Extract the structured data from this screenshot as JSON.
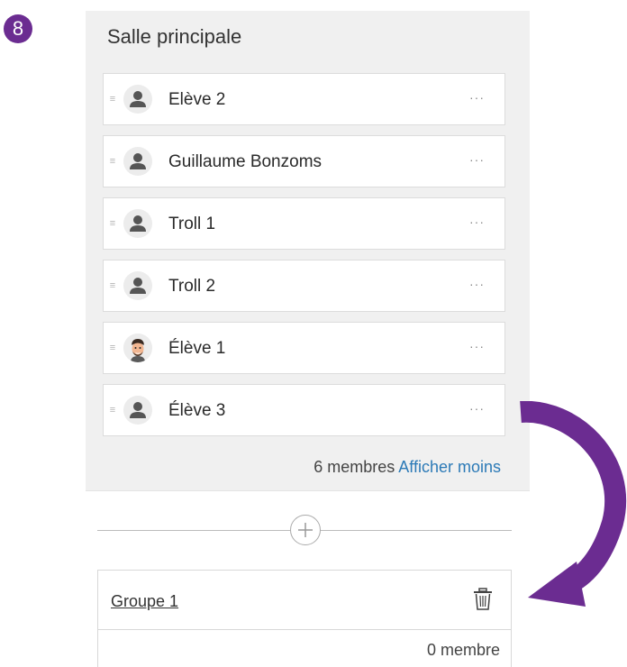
{
  "step_number": "8",
  "room": {
    "title": "Salle principale",
    "members": [
      {
        "name": "Elève 2",
        "avatar": "person-icon"
      },
      {
        "name": "Guillaume Bonzoms",
        "avatar": "person-icon"
      },
      {
        "name": "Troll 1",
        "avatar": "person-icon"
      },
      {
        "name": "Troll 2",
        "avatar": "person-icon"
      },
      {
        "name": "Élève 1",
        "avatar": "emoji-avatar"
      },
      {
        "name": "Élève 3",
        "avatar": "person-icon"
      }
    ],
    "more_label": "···",
    "footer_count": "6 membres",
    "footer_link": "Afficher moins"
  },
  "group": {
    "name": "Groupe 1",
    "count": "0 membre"
  },
  "colors": {
    "accent": "#6b2c91",
    "link": "#2c7ab7",
    "panel_bg": "#f0f0f0"
  }
}
